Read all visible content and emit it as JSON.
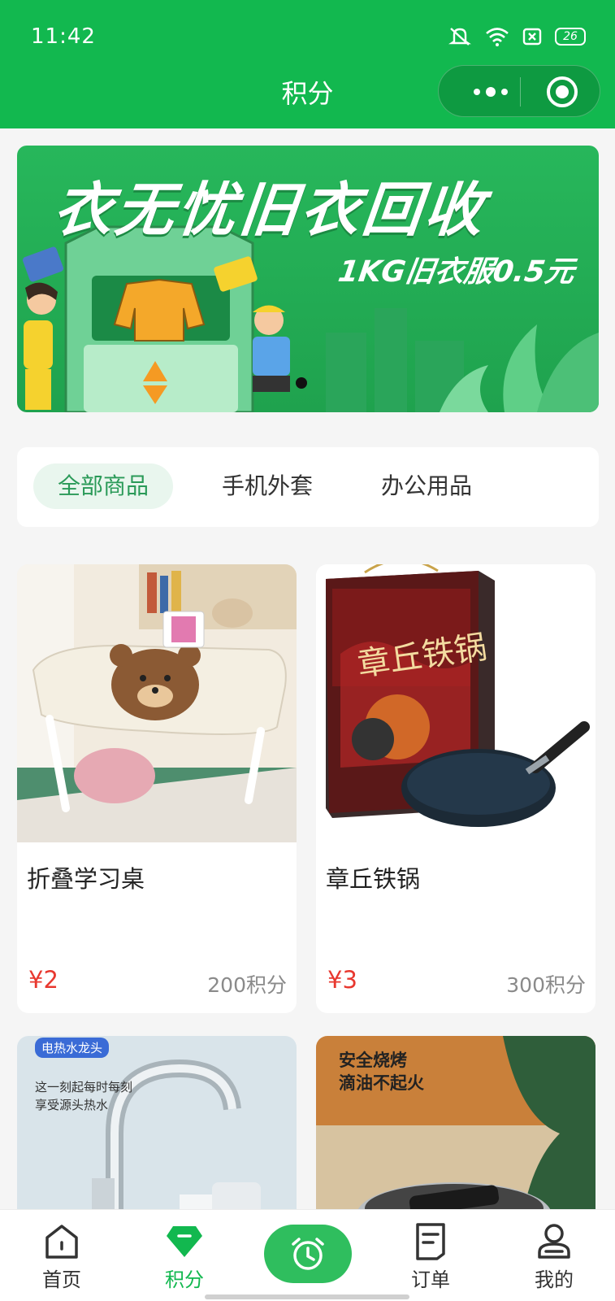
{
  "status_bar": {
    "time": "11:42",
    "battery": "26"
  },
  "nav": {
    "title": "积分"
  },
  "banner": {
    "title": "衣无忧旧衣回收",
    "subtitle": "1KG旧衣服0.5元"
  },
  "category_tabs": [
    {
      "label": "全部商品",
      "active": true
    },
    {
      "label": "手机外套",
      "active": false
    },
    {
      "label": "办公用品",
      "active": false
    }
  ],
  "products": [
    {
      "name": "折叠学习桌",
      "price": "¥2",
      "points": "200积分"
    },
    {
      "name": "章丘铁锅",
      "price": "¥3",
      "points": "300积分"
    },
    {
      "name": "",
      "price": "",
      "points": "",
      "image_text": [
        "电热水龙头",
        "这一刻起每时每刻",
        "享受源头热水"
      ]
    },
    {
      "name": "",
      "price": "",
      "points": "",
      "image_text": [
        "安全烧烤",
        "滴油不起火"
      ]
    }
  ],
  "pan_box_text": "章丘铁锅",
  "tabbar": [
    {
      "label": "首页",
      "icon": "home-icon",
      "active": false
    },
    {
      "label": "积分",
      "icon": "diamond-icon",
      "active": true
    },
    {
      "label": "",
      "icon": "alarm-clock-icon",
      "active": false
    },
    {
      "label": "订单",
      "icon": "order-icon",
      "active": false
    },
    {
      "label": "我的",
      "icon": "user-icon",
      "active": false
    }
  ],
  "colors": {
    "brand_green": "#12b84f",
    "price_red": "#e8382f",
    "tab_active_bg": "#e9f6ee"
  }
}
